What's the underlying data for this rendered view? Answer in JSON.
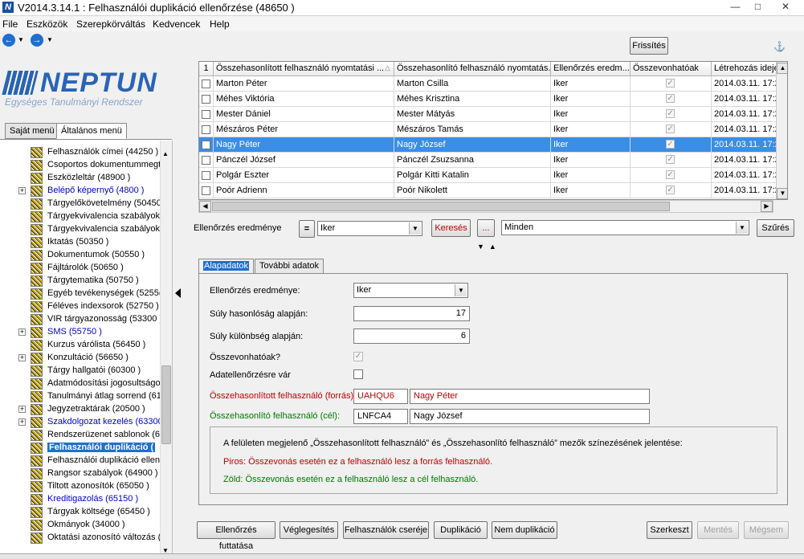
{
  "window": {
    "title": "V2014.3.14.1 : Felhasználói duplikáció ellenőrzése  (48650  )",
    "app_icon": "N"
  },
  "menu": [
    "File",
    "Eszközök",
    "Szerepkörváltás",
    "Kedvencek",
    "Help"
  ],
  "logo": {
    "word": "NEPTUN",
    "subtitle": "Egységes Tanulmányi Rendszer"
  },
  "left_tabs": [
    "Saját menü",
    "Általános menü"
  ],
  "tree": [
    {
      "label": "Felhasználók címei (44250  )",
      "blue": false
    },
    {
      "label": "Csoportos dokumentummegte",
      "blue": false
    },
    {
      "label": "Eszközleltár (48900  )",
      "blue": false
    },
    {
      "label": "Belépő képernyő (4800  )",
      "blue": true,
      "expand": true
    },
    {
      "label": "Tárgyelőkövetelmény (50450",
      "blue": false
    },
    {
      "label": "Tárgyekvivalencia szabályok",
      "blue": false
    },
    {
      "label": "Tárgyekvivalencia szabályok",
      "blue": false
    },
    {
      "label": "Iktatás (50350  )",
      "blue": false
    },
    {
      "label": "Dokumentumok (50550  )",
      "blue": false
    },
    {
      "label": "Fájltárolók (50650  )",
      "blue": false
    },
    {
      "label": "Tárgytematika (50750  )",
      "blue": false
    },
    {
      "label": "Egyéb tevékenységek (5255(",
      "blue": false
    },
    {
      "label": "Féléves indexsorok (52750  )",
      "blue": false
    },
    {
      "label": "VIR tárgyazonosság (53300  )",
      "blue": false
    },
    {
      "label": "SMS (55750  )",
      "blue": true,
      "expand": true
    },
    {
      "label": "Kurzus várólista (56450  )",
      "blue": false
    },
    {
      "label": "Konzultáció (56650  )",
      "blue": false,
      "expand": true
    },
    {
      "label": "Tárgy hallgatói (60300  )",
      "blue": false
    },
    {
      "label": "Adatmódosítási jogosultságok",
      "blue": false
    },
    {
      "label": "Tanulmányi átlag sorrend (61:",
      "blue": false
    },
    {
      "label": "Jegyzetraktárak (20500  )",
      "blue": false,
      "expand": true
    },
    {
      "label": "Szakdolgozat kezelés (63300",
      "blue": true,
      "expand": true
    },
    {
      "label": "Rendszerüzenet sablonok (64",
      "blue": false
    },
    {
      "label": "Felhasználói duplikáció (",
      "blue": false,
      "selected": true
    },
    {
      "label": "Felhasználói duplikáció ellenő",
      "blue": false
    },
    {
      "label": "Rangsor szabályok (64900  )",
      "blue": false
    },
    {
      "label": "Tiltott azonosítók (65050  )",
      "blue": false
    },
    {
      "label": "Kreditigazolás (65150  )",
      "blue": true
    },
    {
      "label": "Tárgyak költsége (65450  )",
      "blue": false
    },
    {
      "label": "Okmányok (34000  )",
      "blue": false
    },
    {
      "label": "Oktatási azonosító változás (",
      "blue": false
    }
  ],
  "toolbar": {
    "refresh": "Frissítés"
  },
  "grid": {
    "headers": [
      "1",
      "Összehasonlított felhasználó nyomtatási ...",
      "Összehasonlító felhasználó nyomtatás...",
      "Ellenőrzés eredm...",
      "Összevonhatóak",
      "Létrehozás ideje"
    ],
    "rows": [
      {
        "a": "Marton Péter",
        "b": "Marton Csilla",
        "res": "Iker",
        "date": "2014.03.11. 17:2"
      },
      {
        "a": "Méhes Viktória",
        "b": "Méhes Krisztina",
        "res": "Iker",
        "date": "2014.03.11. 17:2"
      },
      {
        "a": "Mester Dániel",
        "b": "Mester Mátyás",
        "res": "Iker",
        "date": "2014.03.11. 17:2"
      },
      {
        "a": "Mészáros Péter",
        "b": "Mészáros Tamás",
        "res": "Iker",
        "date": "2014.03.11. 17:2"
      },
      {
        "a": "Nagy Péter",
        "b": "Nagy József",
        "res": "Iker",
        "date": "2014.03.11. 17:2",
        "selected": true
      },
      {
        "a": "Pánczél József",
        "b": "Pánczél Zsuzsanna",
        "res": "Iker",
        "date": "2014.03.11. 17:2"
      },
      {
        "a": "Polgár Eszter",
        "b": "Polgár Kitti Katalin",
        "res": "Iker",
        "date": "2014.03.11. 17:2"
      },
      {
        "a": "Poór Adrienn",
        "b": "Poór Nikolett",
        "res": "Iker",
        "date": "2014.03.11. 17:2"
      }
    ]
  },
  "filter": {
    "label": "Ellenőrzés eredménye",
    "op": "=",
    "value": "Iker",
    "search": "Keresés",
    "dots": "...",
    "scope": "Minden",
    "filter_btn": "Szűrés"
  },
  "detail": {
    "tabs": [
      "Alapadatok",
      "További adatok"
    ],
    "result_label": "Ellenőrzés eredménye:",
    "result_value": "Iker",
    "sim_label": "Súly hasonlóság alapján:",
    "sim_value": "17",
    "diff_label": "Súly különbség alapján:",
    "diff_value": "6",
    "merge_label": "Összevonhatóak?",
    "check_label": "Adatellenőrzésre vár",
    "src_label": "Összehasonlított felhasználó (forrás):",
    "src_code": "UAHQU6",
    "src_name": "Nagy Péter",
    "dst_label": "Összehasonlító felhasználó (cél):",
    "dst_code": "LNFCA4",
    "dst_name": "Nagy József",
    "info_title": "A felületen megjelenő „Összehasonlított felhasználó” és „Összehasonlító felhasználó” mezők színezésének jelentése:",
    "info_red": "Piros: Összevonás esetén ez a felhasználó lesz a forrás felhasználó.",
    "info_green": "Zöld: Összevonás esetén ez a felhasználó lesz a cél felhasználó."
  },
  "actions": [
    "Ellenőrzés futtatása",
    "Véglegesítés",
    "Felhasználók cseréje",
    "Duplikáció",
    "Nem duplikáció"
  ],
  "edit_actions": [
    "Szerkeszt",
    "Mentés",
    "Mégsem"
  ],
  "colors": {
    "accent": "#1e6fd0",
    "source_red": "#c00000",
    "target_green": "#007a00"
  }
}
